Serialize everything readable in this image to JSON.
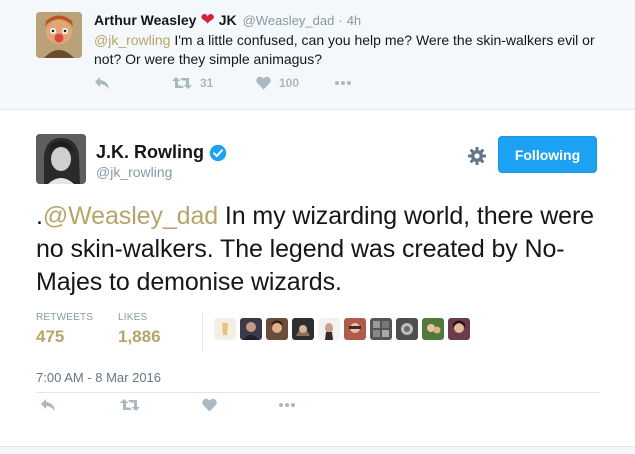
{
  "parent_tweet": {
    "author_name": "Arthur Weasley",
    "author_name_suffix": "JK",
    "handle": "@Weasley_dad",
    "dot": "·",
    "time": "4h",
    "mention": "@jk_rowling",
    "text": " I'm a little confused, can you help me? Were the skin-walkers evil or not? Or were they simple animagus?",
    "retweets": "31",
    "likes": "100",
    "icons": {
      "reply": "reply-icon",
      "retweet": "retweet-icon",
      "like": "heart-icon",
      "more": "more-icon",
      "name_emoji": "red-heart-emoji"
    }
  },
  "main_tweet": {
    "author_name": "J.K. Rowling",
    "handle": "@jk_rowling",
    "follow_label": "Following",
    "text_prefix": ".",
    "mention": "@Weasley_dad",
    "text": " In my wizarding world, there were no skin-walkers. The legend was created by No-Majes to demonise wizards.",
    "retweets_label": "RETWEETS",
    "retweets_value": "475",
    "likes_label": "LIKES",
    "likes_value": "1,886",
    "timestamp": "7:00 AM - 8 Mar 2016",
    "liker_count": 10,
    "icons": {
      "verified": "verified-badge-icon",
      "settings": "gear-icon",
      "reply": "reply-icon",
      "retweet": "retweet-icon",
      "like": "heart-icon",
      "more": "more-icon"
    }
  },
  "colors": {
    "accent": "#1da1f2",
    "mention": "#b8a46a",
    "muted": "#8899a6",
    "action_icon": "#aab8c2",
    "heart_emoji": "#d62335"
  }
}
